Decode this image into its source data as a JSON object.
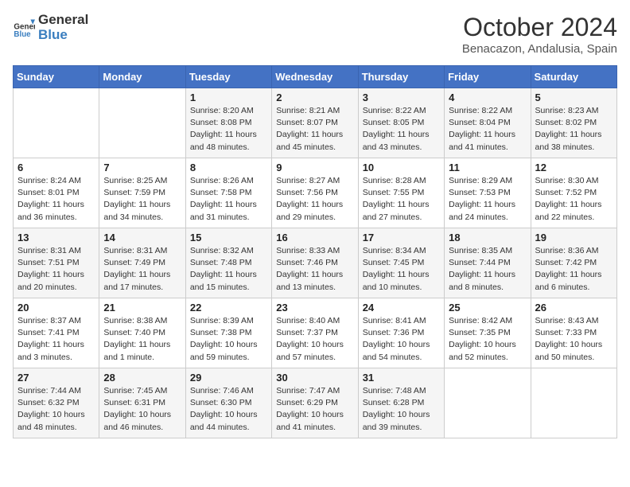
{
  "header": {
    "logo_general": "General",
    "logo_blue": "Blue",
    "month": "October 2024",
    "location": "Benacazon, Andalusia, Spain"
  },
  "weekdays": [
    "Sunday",
    "Monday",
    "Tuesday",
    "Wednesday",
    "Thursday",
    "Friday",
    "Saturday"
  ],
  "weeks": [
    [
      {
        "day": "",
        "info": ""
      },
      {
        "day": "",
        "info": ""
      },
      {
        "day": "1",
        "info": "Sunrise: 8:20 AM\nSunset: 8:08 PM\nDaylight: 11 hours and 48 minutes."
      },
      {
        "day": "2",
        "info": "Sunrise: 8:21 AM\nSunset: 8:07 PM\nDaylight: 11 hours and 45 minutes."
      },
      {
        "day": "3",
        "info": "Sunrise: 8:22 AM\nSunset: 8:05 PM\nDaylight: 11 hours and 43 minutes."
      },
      {
        "day": "4",
        "info": "Sunrise: 8:22 AM\nSunset: 8:04 PM\nDaylight: 11 hours and 41 minutes."
      },
      {
        "day": "5",
        "info": "Sunrise: 8:23 AM\nSunset: 8:02 PM\nDaylight: 11 hours and 38 minutes."
      }
    ],
    [
      {
        "day": "6",
        "info": "Sunrise: 8:24 AM\nSunset: 8:01 PM\nDaylight: 11 hours and 36 minutes."
      },
      {
        "day": "7",
        "info": "Sunrise: 8:25 AM\nSunset: 7:59 PM\nDaylight: 11 hours and 34 minutes."
      },
      {
        "day": "8",
        "info": "Sunrise: 8:26 AM\nSunset: 7:58 PM\nDaylight: 11 hours and 31 minutes."
      },
      {
        "day": "9",
        "info": "Sunrise: 8:27 AM\nSunset: 7:56 PM\nDaylight: 11 hours and 29 minutes."
      },
      {
        "day": "10",
        "info": "Sunrise: 8:28 AM\nSunset: 7:55 PM\nDaylight: 11 hours and 27 minutes."
      },
      {
        "day": "11",
        "info": "Sunrise: 8:29 AM\nSunset: 7:53 PM\nDaylight: 11 hours and 24 minutes."
      },
      {
        "day": "12",
        "info": "Sunrise: 8:30 AM\nSunset: 7:52 PM\nDaylight: 11 hours and 22 minutes."
      }
    ],
    [
      {
        "day": "13",
        "info": "Sunrise: 8:31 AM\nSunset: 7:51 PM\nDaylight: 11 hours and 20 minutes."
      },
      {
        "day": "14",
        "info": "Sunrise: 8:31 AM\nSunset: 7:49 PM\nDaylight: 11 hours and 17 minutes."
      },
      {
        "day": "15",
        "info": "Sunrise: 8:32 AM\nSunset: 7:48 PM\nDaylight: 11 hours and 15 minutes."
      },
      {
        "day": "16",
        "info": "Sunrise: 8:33 AM\nSunset: 7:46 PM\nDaylight: 11 hours and 13 minutes."
      },
      {
        "day": "17",
        "info": "Sunrise: 8:34 AM\nSunset: 7:45 PM\nDaylight: 11 hours and 10 minutes."
      },
      {
        "day": "18",
        "info": "Sunrise: 8:35 AM\nSunset: 7:44 PM\nDaylight: 11 hours and 8 minutes."
      },
      {
        "day": "19",
        "info": "Sunrise: 8:36 AM\nSunset: 7:42 PM\nDaylight: 11 hours and 6 minutes."
      }
    ],
    [
      {
        "day": "20",
        "info": "Sunrise: 8:37 AM\nSunset: 7:41 PM\nDaylight: 11 hours and 3 minutes."
      },
      {
        "day": "21",
        "info": "Sunrise: 8:38 AM\nSunset: 7:40 PM\nDaylight: 11 hours and 1 minute."
      },
      {
        "day": "22",
        "info": "Sunrise: 8:39 AM\nSunset: 7:38 PM\nDaylight: 10 hours and 59 minutes."
      },
      {
        "day": "23",
        "info": "Sunrise: 8:40 AM\nSunset: 7:37 PM\nDaylight: 10 hours and 57 minutes."
      },
      {
        "day": "24",
        "info": "Sunrise: 8:41 AM\nSunset: 7:36 PM\nDaylight: 10 hours and 54 minutes."
      },
      {
        "day": "25",
        "info": "Sunrise: 8:42 AM\nSunset: 7:35 PM\nDaylight: 10 hours and 52 minutes."
      },
      {
        "day": "26",
        "info": "Sunrise: 8:43 AM\nSunset: 7:33 PM\nDaylight: 10 hours and 50 minutes."
      }
    ],
    [
      {
        "day": "27",
        "info": "Sunrise: 7:44 AM\nSunset: 6:32 PM\nDaylight: 10 hours and 48 minutes."
      },
      {
        "day": "28",
        "info": "Sunrise: 7:45 AM\nSunset: 6:31 PM\nDaylight: 10 hours and 46 minutes."
      },
      {
        "day": "29",
        "info": "Sunrise: 7:46 AM\nSunset: 6:30 PM\nDaylight: 10 hours and 44 minutes."
      },
      {
        "day": "30",
        "info": "Sunrise: 7:47 AM\nSunset: 6:29 PM\nDaylight: 10 hours and 41 minutes."
      },
      {
        "day": "31",
        "info": "Sunrise: 7:48 AM\nSunset: 6:28 PM\nDaylight: 10 hours and 39 minutes."
      },
      {
        "day": "",
        "info": ""
      },
      {
        "day": "",
        "info": ""
      }
    ]
  ]
}
